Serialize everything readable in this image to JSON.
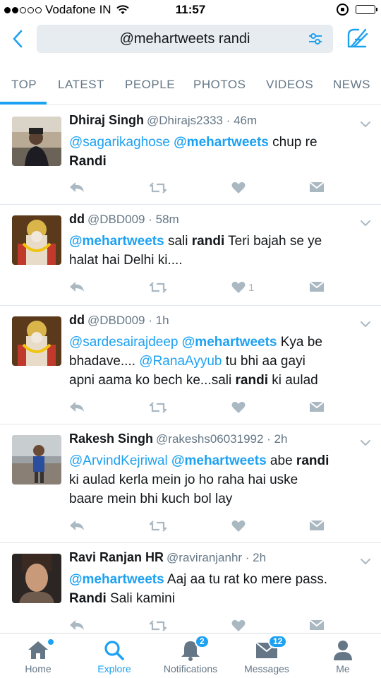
{
  "status_bar": {
    "carrier": "Vodafone IN",
    "time": "11:57",
    "signal_bars_filled": 2,
    "signal_bars_total": 5,
    "battery_level": 0.9
  },
  "search": {
    "query": "@mehartweets randi"
  },
  "tabs": [
    {
      "label": "TOP",
      "active": true
    },
    {
      "label": "LATEST",
      "active": false
    },
    {
      "label": "PEOPLE",
      "active": false
    },
    {
      "label": "PHOTOS",
      "active": false
    },
    {
      "label": "VIDEOS",
      "active": false
    },
    {
      "label": "NEWS",
      "active": false
    }
  ],
  "tweets": [
    {
      "name": "Dhiraj Singh",
      "handle": "@Dhirajs2333",
      "time": "46m",
      "text_lines": [
        [
          {
            "t": "@sagarikaghose",
            "k": "mention"
          },
          {
            "t": " "
          },
          {
            "t": "@mehartweets",
            "k": "mention-bold"
          },
          {
            "t": " chup re"
          }
        ],
        [
          {
            "t": "Randi",
            "k": "bold"
          }
        ]
      ],
      "likes": ""
    },
    {
      "name": "dd",
      "handle": "@DBD009",
      "time": "58m",
      "text_lines": [
        [
          {
            "t": "@mehartweets",
            "k": "mention-bold"
          },
          {
            "t": " sali "
          },
          {
            "t": "randi",
            "k": "bold"
          },
          {
            "t": " Teri bajah se ye"
          }
        ],
        [
          {
            "t": "halat hai Delhi ki...."
          }
        ]
      ],
      "likes": "1"
    },
    {
      "name": "dd",
      "handle": "@DBD009",
      "time": "1h",
      "text_lines": [
        [
          {
            "t": "@sardesairajdeep",
            "k": "mention"
          },
          {
            "t": " "
          },
          {
            "t": "@mehartweets",
            "k": "mention-bold"
          },
          {
            "t": " Kya be"
          }
        ],
        [
          {
            "t": "bhadave.... "
          },
          {
            "t": "@RanaAyyub",
            "k": "mention"
          },
          {
            "t": " tu bhi aa gayi"
          }
        ],
        [
          {
            "t": "apni aama ko bech ke...sali "
          },
          {
            "t": "randi",
            "k": "bold"
          },
          {
            "t": " ki aulad"
          }
        ]
      ],
      "likes": ""
    },
    {
      "name": "Rakesh Singh",
      "handle": "@rakeshs06031992",
      "time": "2h",
      "text_lines": [
        [
          {
            "t": "@ArvindKejriwal",
            "k": "mention"
          },
          {
            "t": " "
          },
          {
            "t": "@mehartweets",
            "k": "mention-bold"
          },
          {
            "t": " abe "
          },
          {
            "t": "randi",
            "k": "bold"
          }
        ],
        [
          {
            "t": "ki aulad kerla mein jo ho raha hai uske"
          }
        ],
        [
          {
            "t": "baare mein bhi kuch bol lay"
          }
        ]
      ],
      "likes": ""
    },
    {
      "name": "Ravi Ranjan HR",
      "handle": "@raviranjanhr",
      "time": "2h",
      "text_lines": [
        [
          {
            "t": "@mehartweets",
            "k": "mention-bold"
          },
          {
            "t": " Aaj aa tu rat ko mere pass."
          }
        ],
        [
          {
            "t": "Randi",
            "k": "bold"
          },
          {
            "t": " Sali kamini"
          }
        ]
      ],
      "likes": ""
    }
  ],
  "tab_bar": [
    {
      "label": "Home",
      "icon": "home-icon",
      "active": false,
      "badge": "",
      "dot": true
    },
    {
      "label": "Explore",
      "icon": "search-icon",
      "active": true,
      "badge": "",
      "dot": false
    },
    {
      "label": "Notifications",
      "icon": "bell-icon",
      "active": false,
      "badge": "2",
      "dot": false
    },
    {
      "label": "Messages",
      "icon": "envelope-icon",
      "active": false,
      "badge": "12",
      "dot": false
    },
    {
      "label": "Me",
      "icon": "person-icon",
      "active": false,
      "badge": "",
      "dot": false
    }
  ],
  "colors": {
    "accent": "#1da1f2",
    "text": "#14171a",
    "muted": "#657786",
    "action_gray": "#aab8c2"
  }
}
